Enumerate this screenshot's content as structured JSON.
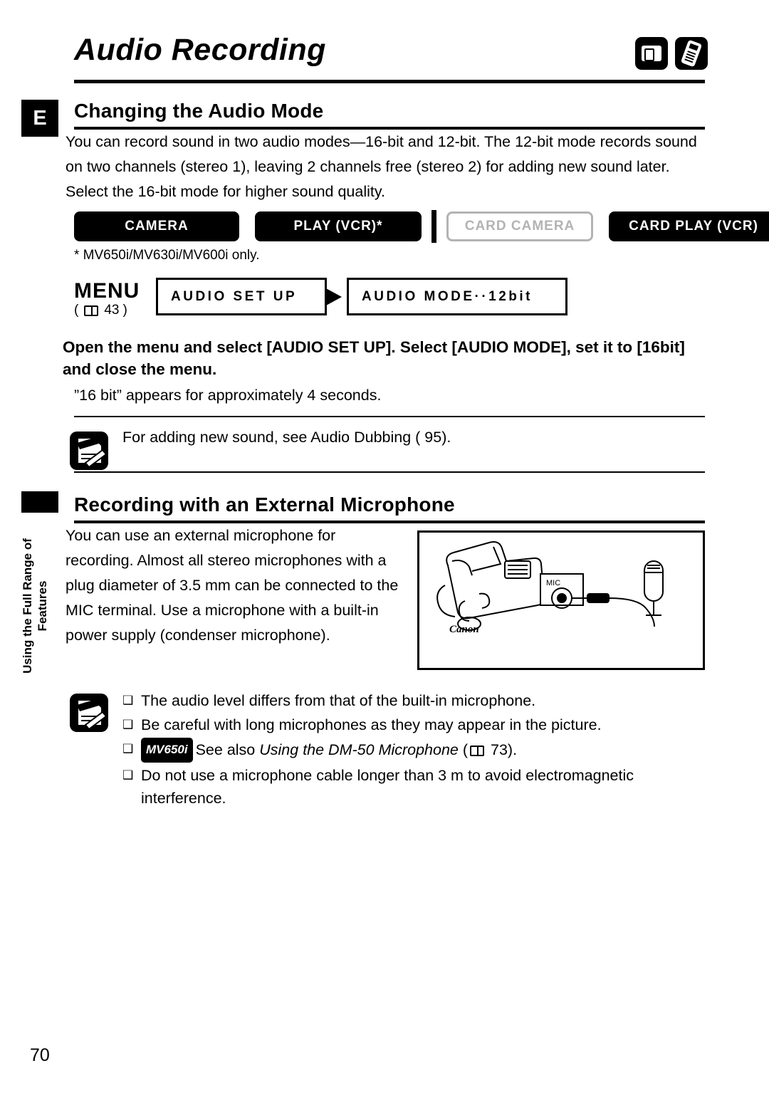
{
  "header": {
    "title": "Audio Recording",
    "icons": [
      "camera-mode-icon",
      "remote-mode-icon"
    ],
    "language_tab": "E"
  },
  "side_tab": {
    "text": "Using the Full Range of Features"
  },
  "sections": [
    {
      "heading": "Changing the Audio Mode",
      "paragraph": "You can record sound in two audio modes—16-bit and 12-bit. The 12-bit mode records sound on two channels (stereo 1), leaving 2 channels free (stereo 2) for adding new sound later. Select the 16-bit mode for higher sound quality.",
      "modes": [
        {
          "label": "CAMERA",
          "enabled": true
        },
        {
          "label": "PLAY (VCR)*",
          "enabled": true
        },
        {
          "label": "CARD CAMERA",
          "enabled": false
        },
        {
          "label": "CARD PLAY (VCR)",
          "enabled": true
        }
      ],
      "footnote": "* MV650i/MV630i/MV600i only.",
      "menu": {
        "label": "MENU",
        "reference": "43",
        "item1": "AUDIO SET UP",
        "item2": "AUDIO MODE··12bit"
      },
      "instruction": "Open the menu and select [AUDIO SET UP]. Select [AUDIO MODE], set it to [16bit] and close the menu.",
      "subnote": "”16 bit” appears for approximately 4 seconds.",
      "note": "For adding new sound, see Audio Dubbing ( 95)."
    },
    {
      "heading": "Recording with an External Microphone",
      "paragraph": "You can use an external microphone for recording. Almost all stereo microphones with a plug diameter of 3.5 mm can be connected to the MIC terminal. Use a microphone with a built-in power supply (condenser microphone).",
      "illustration": {
        "mic_terminal_label": "MIC",
        "brand": "Canon"
      },
      "bullets": [
        {
          "mark": "❑",
          "text": "The audio level differs from that of the built-in microphone."
        },
        {
          "mark": "❑",
          "text": "Be careful with long microphones as they may appear in the picture."
        },
        {
          "mark": "❑",
          "badge": "MV650i",
          "text": "See also Using the DM-50 Microphone ( 73).",
          "italic_part": "Using the DM-50 Microphone"
        },
        {
          "mark": "❑",
          "text": "Do not use a microphone cable longer than 3 m to avoid electromagnetic interference."
        }
      ]
    }
  ],
  "page_number": "70"
}
